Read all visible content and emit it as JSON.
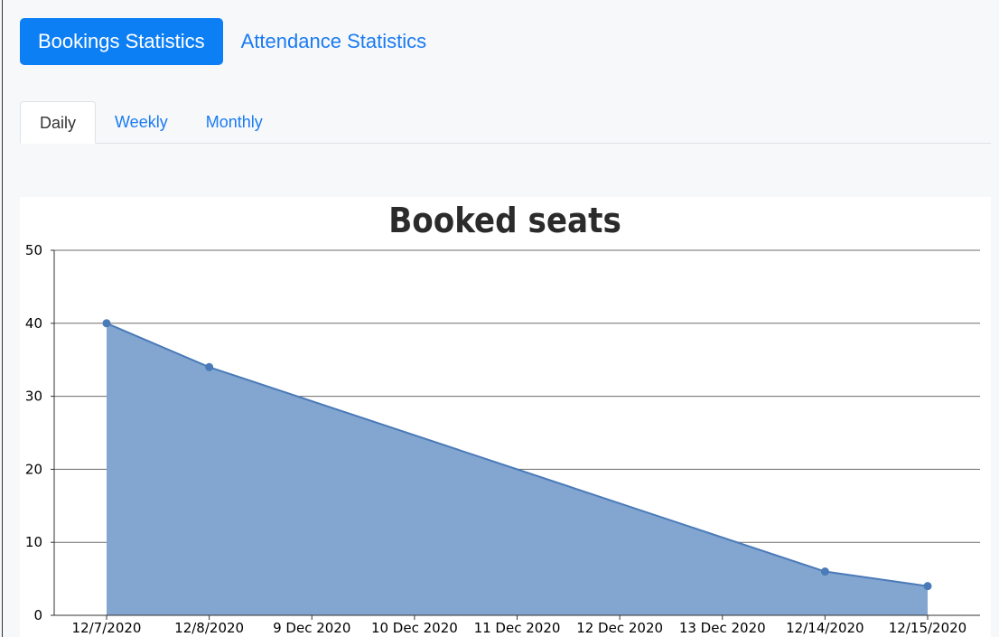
{
  "nav": {
    "pills": [
      {
        "label": "Bookings Statistics",
        "active": true
      },
      {
        "label": "Attendance Statistics",
        "active": false
      }
    ]
  },
  "tabs": [
    {
      "label": "Daily",
      "active": true
    },
    {
      "label": "Weekly",
      "active": false
    },
    {
      "label": "Monthly",
      "active": false
    }
  ],
  "colors": {
    "accent": "#0d7ff5",
    "link": "#1a7bf2",
    "area_fill": "#83a6d0",
    "area_line": "#4a7ab8"
  },
  "chart_data": {
    "type": "area",
    "title": "Booked seats",
    "xlabel": "",
    "ylabel": "",
    "categories": [
      "12/7/2020",
      "12/8/2020",
      "9 Dec 2020",
      "10 Dec 2020",
      "11 Dec 2020",
      "12 Dec 2020",
      "13 Dec 2020",
      "12/14/2020",
      "12/15/2020"
    ],
    "points": [
      {
        "x": "12/7/2020",
        "y": 40
      },
      {
        "x": "12/8/2020",
        "y": 34
      },
      {
        "x": "12/14/2020",
        "y": 6
      },
      {
        "x": "12/15/2020",
        "y": 4
      }
    ],
    "ylim": [
      0,
      50
    ],
    "yticks": [
      0,
      10,
      20,
      30,
      40,
      50
    ],
    "grid": true,
    "legend": "none"
  }
}
